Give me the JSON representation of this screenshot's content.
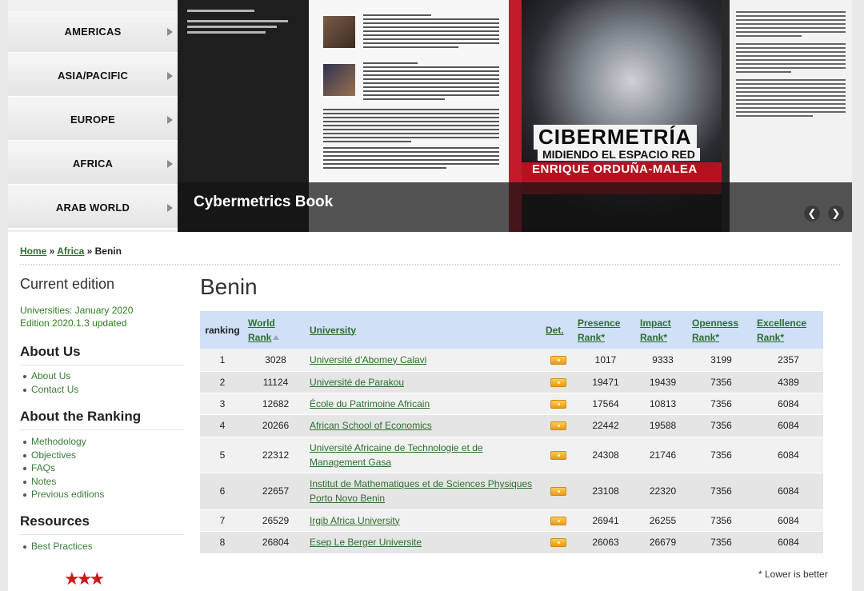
{
  "regions": [
    "AMERICAS",
    "ASIA/PACIFIC",
    "EUROPE",
    "AFRICA",
    "ARAB WORLD"
  ],
  "banner": {
    "caption": "Cybermetrics Book",
    "cover_title": "CIBERMETRÍA",
    "cover_subtitle": "MIDIENDO EL ESPACIO RED",
    "cover_author": "ENRIQUE ORDUÑA-MALEA",
    "prev_glyph": "❮",
    "next_glyph": "❯"
  },
  "breadcrumb": {
    "home": "Home",
    "sep1": " » ",
    "africa": "Africa",
    "sep2": " » ",
    "current": "Benin"
  },
  "sidebar": {
    "current_edition_title": "Current edition",
    "edition_line1": "Universities: January 2020",
    "edition_line2": "Edition 2020.1.3 updated",
    "about_us_title": "About Us",
    "about_us_links": [
      "About Us",
      "Contact Us"
    ],
    "about_ranking_title": "About the Ranking",
    "about_ranking_links": [
      "Methodology",
      "Objectives",
      "FAQs",
      "Notes",
      "Previous editions"
    ],
    "resources_title": "Resources",
    "resources_links": [
      "Best Practices"
    ],
    "stars": "★★★"
  },
  "main": {
    "title": "Benin",
    "headers": {
      "ranking": "ranking",
      "world_rank_1": "World",
      "world_rank_2": "Rank",
      "university": "University",
      "det": "Det.",
      "presence_1": "Presence",
      "presence_2": "Rank*",
      "impact_1": "Impact",
      "impact_2": "Rank*",
      "openness_1": "Openness",
      "openness_2": "Rank*",
      "excellence_1": "Excellence",
      "excellence_2": "Rank*"
    },
    "rows": [
      {
        "ranking": "1",
        "world": "3028",
        "university": "Université d'Abomey Calavi",
        "presence": "1017",
        "impact": "9333",
        "openness": "3199",
        "excellence": "2357"
      },
      {
        "ranking": "2",
        "world": "11124",
        "university": "Université de Parakou",
        "presence": "19471",
        "impact": "19439",
        "openness": "7356",
        "excellence": "4389"
      },
      {
        "ranking": "3",
        "world": "12682",
        "university": "École du Patrimoine Africain",
        "presence": "17564",
        "impact": "10813",
        "openness": "7356",
        "excellence": "6084"
      },
      {
        "ranking": "4",
        "world": "20266",
        "university": "African School of Economics",
        "presence": "22442",
        "impact": "19588",
        "openness": "7356",
        "excellence": "6084"
      },
      {
        "ranking": "5",
        "world": "22312",
        "university": "Université Africaine de Technologie et de Management Gasa",
        "presence": "24308",
        "impact": "21746",
        "openness": "7356",
        "excellence": "6084"
      },
      {
        "ranking": "6",
        "world": "22657",
        "university": "Institut de Mathematiques et de Sciences Physiques Porto Novo Benin",
        "presence": "23108",
        "impact": "22320",
        "openness": "7356",
        "excellence": "6084"
      },
      {
        "ranking": "7",
        "world": "26529",
        "university": "Irgib Africa University",
        "presence": "26941",
        "impact": "26255",
        "openness": "7356",
        "excellence": "6084"
      },
      {
        "ranking": "8",
        "world": "26804",
        "university": "Esep Le Berger Universite",
        "presence": "26063",
        "impact": "26679",
        "openness": "7356",
        "excellence": "6084"
      }
    ],
    "footnote": "* Lower is better"
  }
}
